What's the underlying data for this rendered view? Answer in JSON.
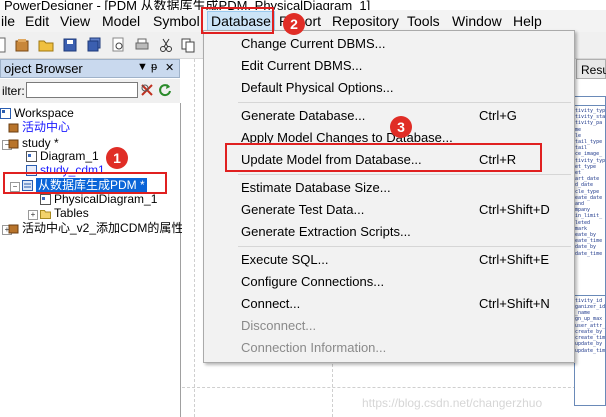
{
  "window": {
    "title": "PowerDesigner - [PDM 从数据库生成PDM, PhysicalDiagram_1]"
  },
  "menubar": {
    "items": [
      "ile",
      "Edit",
      "View",
      "Model",
      "Symbol",
      "Database",
      "Report",
      "Repository",
      "Tools",
      "Window",
      "Help"
    ],
    "active": "Database"
  },
  "browser": {
    "title": "oject Browser",
    "filter_label": "ilter:",
    "filter_value": "",
    "tree": {
      "workspace": "Workspace",
      "item1": "活动中心",
      "item2": "study *",
      "item3": "Diagram_1",
      "item4": "study_cdm1",
      "item5": "从数据库生成PDM *",
      "item6": "PhysicalDiagram_1",
      "item7": "Tables",
      "item8": "活动中心_v2_添加CDM的属性"
    }
  },
  "dropdown": {
    "items": [
      {
        "label": "Change Current DBMS...",
        "shortcut": "",
        "disabled": false
      },
      {
        "label": "Edit Current DBMS...",
        "shortcut": "",
        "disabled": false
      },
      {
        "label": "Default Physical Options...",
        "shortcut": "",
        "disabled": false
      },
      {
        "label": "Generate Database...",
        "shortcut": "Ctrl+G",
        "disabled": false
      },
      {
        "label": "Apply Model Changes to Database...",
        "shortcut": "",
        "disabled": false
      },
      {
        "label": "Update Model from Database...",
        "shortcut": "Ctrl+R",
        "disabled": false
      },
      {
        "label": "Estimate Database Size...",
        "shortcut": "",
        "disabled": false
      },
      {
        "label": "Generate Test Data...",
        "shortcut": "Ctrl+Shift+D",
        "disabled": false
      },
      {
        "label": "Generate Extraction Scripts...",
        "shortcut": "",
        "disabled": false
      },
      {
        "label": "Execute SQL...",
        "shortcut": "Ctrl+Shift+E",
        "disabled": false
      },
      {
        "label": "Configure Connections...",
        "shortcut": "",
        "disabled": false
      },
      {
        "label": "Connect...",
        "shortcut": "Ctrl+Shift+N",
        "disabled": false
      },
      {
        "label": "Disconnect...",
        "shortcut": "",
        "disabled": true
      },
      {
        "label": "Connection Information...",
        "shortcut": "",
        "disabled": true
      }
    ]
  },
  "result_tab": {
    "label": "Resu"
  },
  "entity_lines_a": [
    "tivity_typ",
    "tivity_sta",
    "tivity_pa",
    "me",
    "le",
    "tail_type",
    "tail",
    "ce_image_",
    "tivity_typ",
    "et_type",
    "et",
    "art_date",
    "d_date",
    "cle_type",
    "eate_date",
    "and",
    "mpany",
    "in_limit_",
    "leted",
    "mark",
    "eate_by",
    "eate_time",
    "date_by",
    "date_time"
  ],
  "entity_lines_b": [
    "tivity_id",
    "ganizer_id",
    "_name",
    "gn_up_max",
    "user_attr_s",
    "create_by",
    "create_time",
    "update_by",
    "update_time"
  ],
  "callouts": [
    "1",
    "2",
    "3"
  ],
  "watermark": "https://blog.csdn.net/changerzhuo",
  "colors": {
    "callout": "#e02020",
    "selection": "#0a64d8",
    "menu_active": "#cce4f7"
  }
}
